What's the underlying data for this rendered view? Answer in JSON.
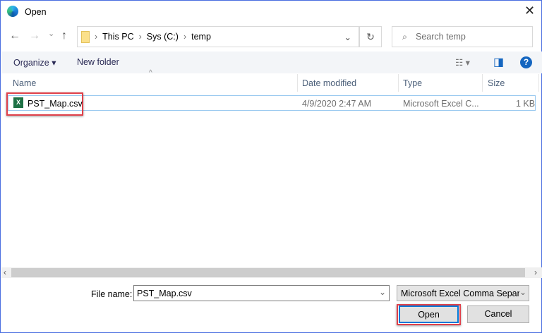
{
  "window": {
    "title": "Open",
    "close_glyph": "✕"
  },
  "nav": {
    "back": "←",
    "forward": "→",
    "recent": "⌄",
    "up": "↑",
    "breadcrumb": [
      "This PC",
      "Sys (C:)",
      "temp"
    ],
    "dropdown": "⌄",
    "refresh": "↻",
    "search_placeholder": "Search temp"
  },
  "toolbar": {
    "organize": "Organize ▾",
    "new_folder": "New folder",
    "view": "☷ ▾",
    "pane": "◨",
    "help": "?"
  },
  "columns": [
    "Name",
    "Date modified",
    "Type",
    "Size"
  ],
  "files": [
    {
      "name": "PST_Map.csv",
      "date": "4/9/2020 2:47 AM",
      "type": "Microsoft Excel C...",
      "size": "1 KB",
      "icon": "excel-csv-icon"
    }
  ],
  "bottom": {
    "file_name_label": "File name:",
    "file_name_value": "PST_Map.csv",
    "filter": "Microsoft Excel Comma Separa",
    "open": "Open",
    "cancel": "Cancel"
  },
  "colors": {
    "highlight": "#e0404a",
    "accent": "#1566c0"
  }
}
